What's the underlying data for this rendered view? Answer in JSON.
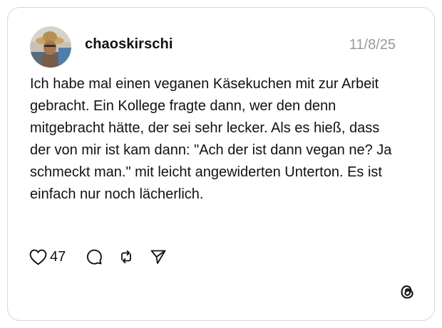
{
  "post": {
    "username": "chaoskirschi",
    "date": "11/8/25",
    "text": "Ich habe mal einen veganen Käsekuchen mit zur Arbeit gebracht. Ein Kollege fragte dann, wer den denn mitgebracht hätte, der sei sehr lecker. Als es hieß, dass der von mir ist kam dann: \"Ach der ist dann vegan ne? Ja schmeckt man.\" mit leicht angewiderten Unterton. Es ist einfach nur noch lächerlich.",
    "like_count": "47"
  },
  "icons": {
    "like": "heart-icon",
    "comment": "speech-bubble-icon",
    "repost": "repost-arrows-icon",
    "share": "paper-plane-icon",
    "brand": "threads-logo-icon"
  },
  "colors": {
    "text": "#111111",
    "muted": "#999999",
    "border": "#d6d6d6",
    "background": "#ffffff"
  }
}
